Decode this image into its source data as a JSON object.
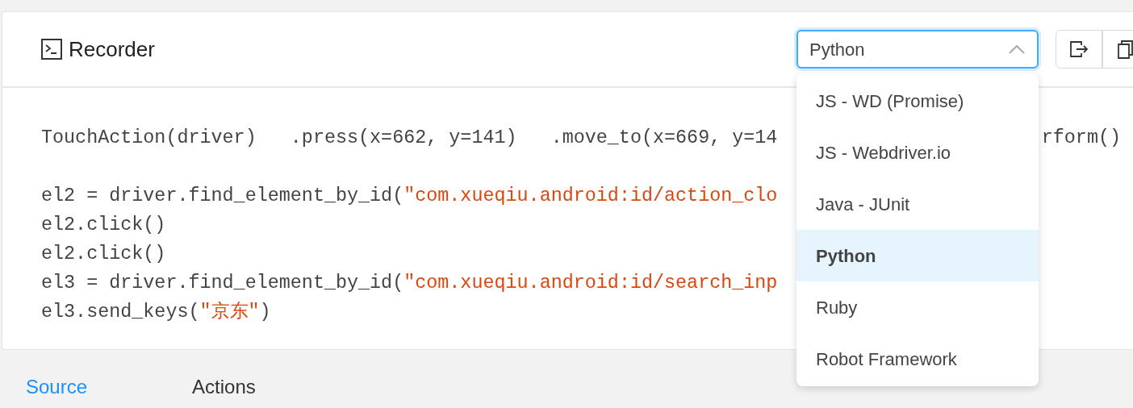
{
  "recorder": {
    "title": "Recorder",
    "language_select": {
      "value": "Python",
      "expanded": true
    },
    "code_blocks": [
      [
        {
          "segments": [
            {
              "kind": "plain",
              "text": "TouchAction(driver)   .press(x=662, y=141)   .move_to(x=669, y=14"
            }
          ],
          "trailing": "rform()"
        }
      ],
      [
        {
          "segments": [
            {
              "kind": "plain",
              "text": "el2 = driver.find_element_by_id("
            },
            {
              "kind": "string",
              "text": "\"com.xueqiu.android:id/action_clo"
            }
          ]
        },
        {
          "segments": [
            {
              "kind": "plain",
              "text": "el2.click()"
            }
          ]
        },
        {
          "segments": [
            {
              "kind": "plain",
              "text": "el2.click()"
            }
          ]
        },
        {
          "segments": [
            {
              "kind": "plain",
              "text": "el3 = driver.find_element_by_id("
            },
            {
              "kind": "string",
              "text": "\"com.xueqiu.android:id/search_inp"
            }
          ]
        },
        {
          "segments": [
            {
              "kind": "plain",
              "text": "el3.send_keys("
            },
            {
              "kind": "string",
              "text": "\"京东\""
            },
            {
              "kind": "plain",
              "text": ")"
            }
          ]
        }
      ]
    ],
    "language_options": [
      {
        "label": "JS - WD (Promise)",
        "selected": false
      },
      {
        "label": "JS - Webdriver.io",
        "selected": false
      },
      {
        "label": "Java - JUnit",
        "selected": false
      },
      {
        "label": "Python",
        "selected": true
      },
      {
        "label": "Ruby",
        "selected": false
      },
      {
        "label": "Robot Framework",
        "selected": false
      }
    ]
  },
  "tabs": [
    {
      "label": "Source",
      "selected": true
    },
    {
      "label": "Actions",
      "selected": false
    }
  ]
}
